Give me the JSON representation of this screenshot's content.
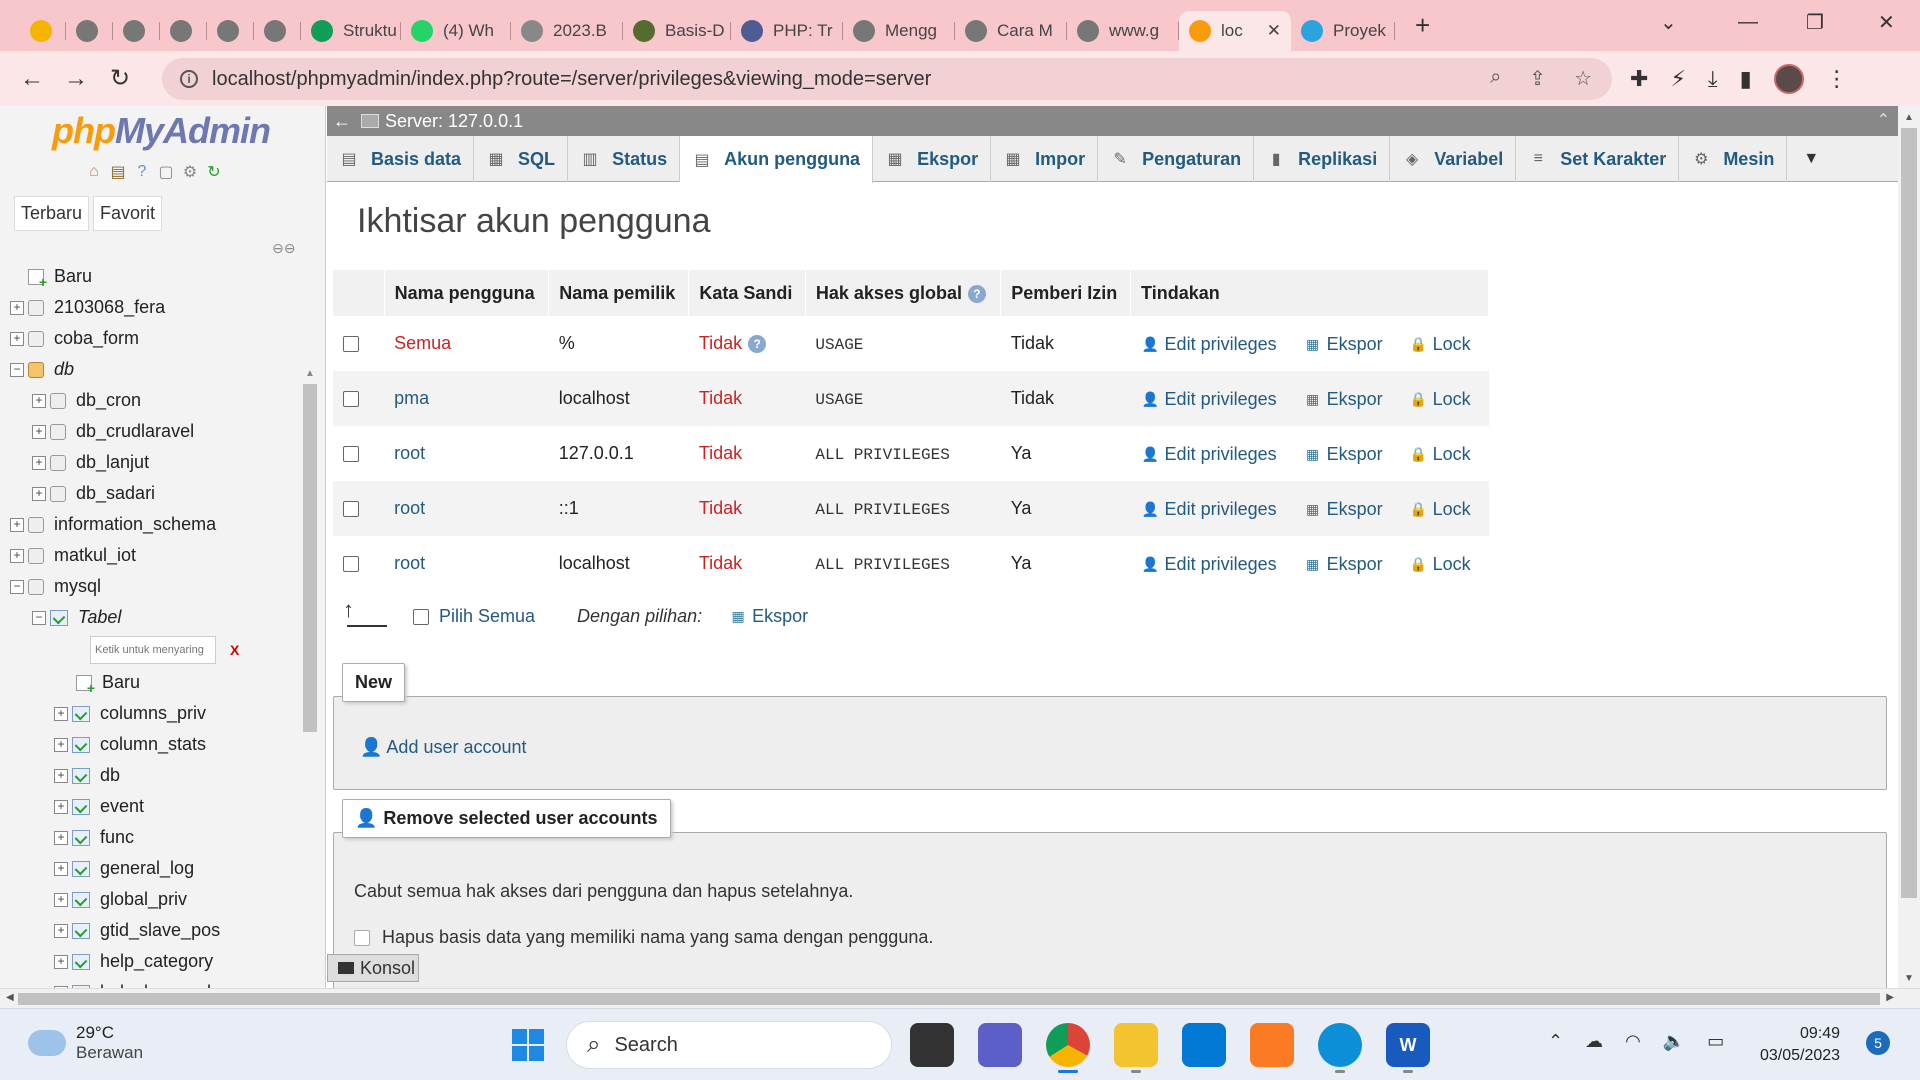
{
  "browser": {
    "tabs": [
      {
        "label": "",
        "favicon": "drive-icon",
        "color": "#f4b400"
      },
      {
        "label": "",
        "favicon": "globe-icon",
        "color": "#777777"
      },
      {
        "label": "",
        "favicon": "globe-icon",
        "color": "#777777"
      },
      {
        "label": "",
        "favicon": "globe-icon",
        "color": "#777777"
      },
      {
        "label": "",
        "favicon": "globe-icon",
        "color": "#777777"
      },
      {
        "label": "",
        "favicon": "globe-icon",
        "color": "#777777"
      },
      {
        "label": "Struktu",
        "favicon": "plus-square-icon",
        "color": "#0f9d58"
      },
      {
        "label": "(4) Wh",
        "favicon": "whatsapp-icon",
        "color": "#25d366"
      },
      {
        "label": "2023.B",
        "favicon": "doc-icon",
        "color": "#888888"
      },
      {
        "label": "Basis-D",
        "favicon": "globe-icon",
        "color": "#556b2f"
      },
      {
        "label": "PHP: Tr",
        "favicon": "php-icon",
        "color": "#4f5b93"
      },
      {
        "label": "Mengg",
        "favicon": "globe-icon",
        "color": "#777777"
      },
      {
        "label": "Cara M",
        "favicon": "globe-icon",
        "color": "#777777"
      },
      {
        "label": "www.g",
        "favicon": "globe-icon",
        "color": "#777777"
      },
      {
        "label": "loc",
        "favicon": "pma-icon",
        "color": "#f89c0e",
        "active": true
      },
      {
        "label": "Proyek",
        "favicon": "telegram-icon",
        "color": "#2aa3df"
      }
    ],
    "url": "localhost/phpmyadmin/index.php?route=/server/privileges&viewing_mode=server"
  },
  "sidebar": {
    "logo_php": "php",
    "logo_myadmin": "MyAdmin",
    "tabs": [
      "Terbaru",
      "Favorit"
    ],
    "tree": [
      {
        "label": "Baru",
        "level": 0,
        "type": "new"
      },
      {
        "label": "2103068_fera",
        "level": 0,
        "type": "db"
      },
      {
        "label": "coba_form",
        "level": 0,
        "type": "db"
      },
      {
        "label": "db",
        "level": 0,
        "type": "group",
        "italic": true
      },
      {
        "label": "db_cron",
        "level": 1,
        "type": "db"
      },
      {
        "label": "db_crudlaravel",
        "level": 1,
        "type": "db"
      },
      {
        "label": "db_lanjut",
        "level": 1,
        "type": "db"
      },
      {
        "label": "db_sadari",
        "level": 1,
        "type": "db"
      },
      {
        "label": "information_schema",
        "level": 0,
        "type": "db"
      },
      {
        "label": "matkul_iot",
        "level": 0,
        "type": "db"
      },
      {
        "label": "mysql",
        "level": 0,
        "type": "db-open"
      },
      {
        "label": "Tabel",
        "level": 1,
        "type": "tables",
        "italic": true
      }
    ],
    "filter_placeholder": "Ketik untuk menyaring",
    "filter_clear": "X",
    "tables": [
      "Baru",
      "columns_priv",
      "column_stats",
      "db",
      "event",
      "func",
      "general_log",
      "global_priv",
      "gtid_slave_pos",
      "help_category",
      "help_keyword"
    ]
  },
  "main": {
    "server_label": "Server: 127.0.0.1",
    "tabs": [
      {
        "label": "Basis data",
        "icon": "database-icon"
      },
      {
        "label": "SQL",
        "icon": "sql-icon"
      },
      {
        "label": "Status",
        "icon": "status-icon"
      },
      {
        "label": "Akun pengguna",
        "icon": "users-icon",
        "active": true
      },
      {
        "label": "Ekspor",
        "icon": "export-icon"
      },
      {
        "label": "Impor",
        "icon": "import-icon"
      },
      {
        "label": "Pengaturan",
        "icon": "settings-icon"
      },
      {
        "label": "Replikasi",
        "icon": "replication-icon"
      },
      {
        "label": "Variabel",
        "icon": "variables-icon"
      },
      {
        "label": "Set Karakter",
        "icon": "charset-icon"
      },
      {
        "label": "Mesin",
        "icon": "engine-icon"
      }
    ],
    "title": "Ikhtisar akun pengguna",
    "table": {
      "headers": [
        "",
        "Nama pengguna",
        "Nama pemilik",
        "Kata Sandi",
        "Hak akses global",
        "Pemberi Izin",
        "Tindakan"
      ],
      "rows": [
        {
          "user": "Semua",
          "user_red": true,
          "host": "%",
          "password": "Tidak",
          "password_help": true,
          "privileges": "USAGE",
          "grant": "Tidak"
        },
        {
          "user": "pma",
          "user_red": false,
          "host": "localhost",
          "password": "Tidak",
          "password_help": false,
          "privileges": "USAGE",
          "grant": "Tidak"
        },
        {
          "user": "root",
          "user_red": false,
          "host": "127.0.0.1",
          "password": "Tidak",
          "password_help": false,
          "privileges": "ALL PRIVILEGES",
          "grant": "Ya"
        },
        {
          "user": "root",
          "user_red": false,
          "host": "::1",
          "password": "Tidak",
          "password_help": false,
          "privileges": "ALL PRIVILEGES",
          "grant": "Ya"
        },
        {
          "user": "root",
          "user_red": false,
          "host": "localhost",
          "password": "Tidak",
          "password_help": false,
          "privileges": "ALL PRIVILEGES",
          "grant": "Ya"
        }
      ],
      "actions": {
        "edit": "Edit privileges",
        "export": "Ekspor",
        "lock": "Lock"
      }
    },
    "bulk": {
      "select_all": "Pilih Semua",
      "with_selected": "Dengan pilihan:",
      "export": "Ekspor"
    },
    "new_legend": "New",
    "add_user": "Add user account",
    "remove_legend": "Remove selected user accounts",
    "remove_desc": "Cabut semua hak akses dari pengguna dan hapus setelahnya.",
    "remove_option": "Hapus basis data yang memiliki nama yang sama dengan pengguna.",
    "console": "Konsol"
  },
  "taskbar": {
    "temp": "29°C",
    "weather": "Berawan",
    "search": "Search",
    "time": "09:49",
    "date": "03/05/2023",
    "notifications": "5",
    "apps": [
      {
        "name": "task-view",
        "label": "",
        "color": "#333333"
      },
      {
        "name": "chat",
        "label": "",
        "color": "#5b5fc7"
      },
      {
        "name": "chrome",
        "label": "",
        "color": "#db4437"
      },
      {
        "name": "file-explorer",
        "label": "",
        "color": "#f4c430"
      },
      {
        "name": "vscode",
        "label": "",
        "color": "#0078d4"
      },
      {
        "name": "xampp",
        "label": "",
        "color": "#fb7a24"
      },
      {
        "name": "edge",
        "label": "",
        "color": "#0c8fd6"
      },
      {
        "name": "word",
        "label": "W",
        "color": "#185abd"
      }
    ]
  }
}
